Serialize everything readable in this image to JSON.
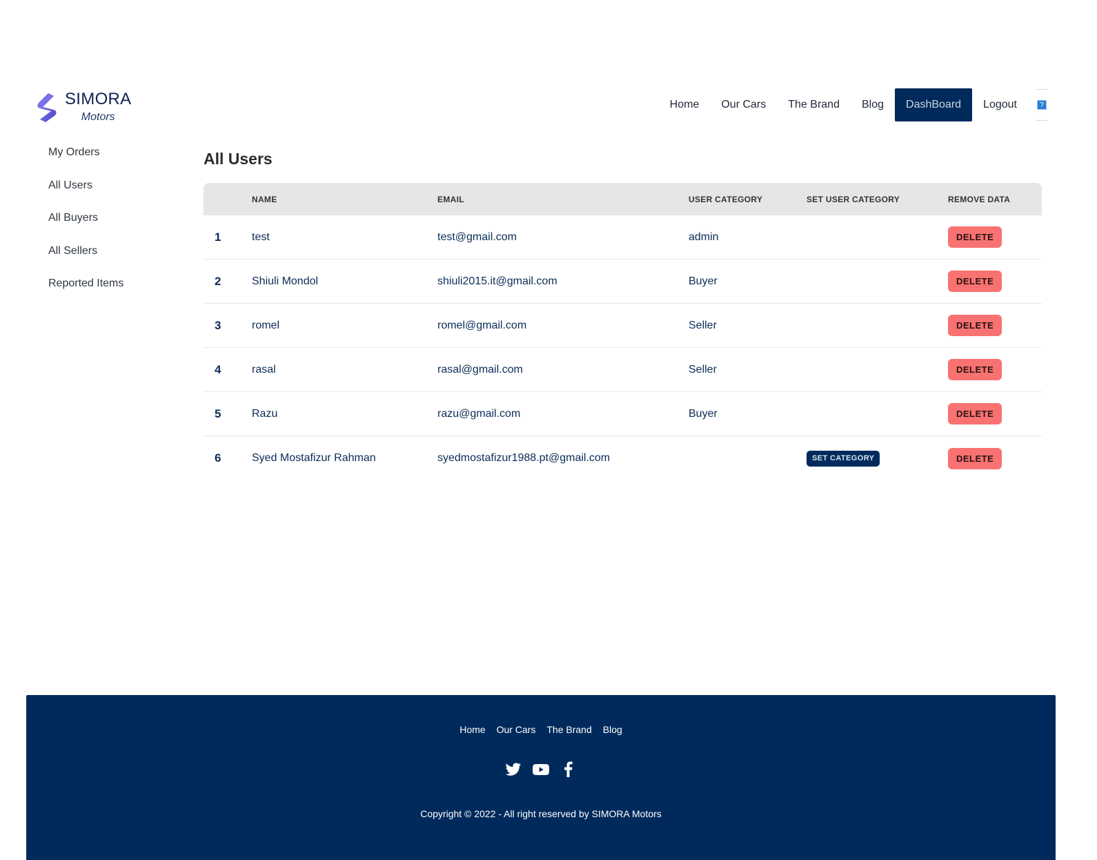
{
  "brand": {
    "name": "SIMORA",
    "subtitle": "Motors",
    "logo_icon": "simora-s-logo"
  },
  "nav": {
    "items": [
      {
        "label": "Home",
        "active": false
      },
      {
        "label": "Our Cars",
        "active": false
      },
      {
        "label": "The Brand",
        "active": false
      },
      {
        "label": "Blog",
        "active": false
      },
      {
        "label": "DashBoard",
        "active": true
      },
      {
        "label": "Logout",
        "active": false
      }
    ],
    "help_icon": "broken-image-icon"
  },
  "sidebar": {
    "items": [
      {
        "label": "My Orders"
      },
      {
        "label": "All Users"
      },
      {
        "label": "All Buyers"
      },
      {
        "label": "All Sellers"
      },
      {
        "label": "Reported Items"
      }
    ]
  },
  "main": {
    "title": "All Users",
    "columns": [
      "",
      "NAME",
      "EMAIL",
      "USER CATEGORY",
      "SET USER CATEGORY",
      "REMOVE DATA"
    ],
    "rows": [
      {
        "num": "1",
        "name": "test",
        "email": "test@gmail.com",
        "category": "admin",
        "set_category": "",
        "action": "DELETE"
      },
      {
        "num": "2",
        "name": "Shiuli Mondol",
        "email": "shiuli2015.it@gmail.com",
        "category": "Buyer",
        "set_category": "",
        "action": "DELETE"
      },
      {
        "num": "3",
        "name": "romel",
        "email": "romel@gmail.com",
        "category": "Seller",
        "set_category": "",
        "action": "DELETE"
      },
      {
        "num": "4",
        "name": "rasal",
        "email": "rasal@gmail.com",
        "category": "Seller",
        "set_category": "",
        "action": "DELETE"
      },
      {
        "num": "5",
        "name": "Razu",
        "email": "razu@gmail.com",
        "category": "Buyer",
        "set_category": "",
        "action": "DELETE"
      },
      {
        "num": "6",
        "name": "Syed Mostafizur Rahman",
        "email": "syedmostafizur1988.pt@gmail.com",
        "category": "",
        "set_category": "SET CATEGORY",
        "action": "DELETE"
      }
    ]
  },
  "footer": {
    "links": [
      "Home",
      "Our Cars",
      "The Brand",
      "Blog"
    ],
    "socials": [
      "twitter-icon",
      "youtube-icon",
      "facebook-icon"
    ],
    "copyright": "Copyright © 2022 - All right reserved by SIMORA Motors"
  },
  "colors": {
    "primary": "#002a5c",
    "delete": "#f87272",
    "table_header": "#e6e6e6",
    "logo": "#6b63e0"
  }
}
